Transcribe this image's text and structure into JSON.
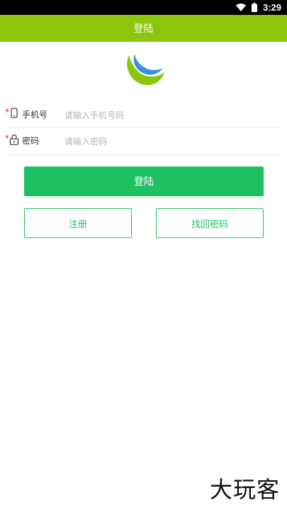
{
  "status_bar": {
    "time": "3:29",
    "wifi_icon": "wifi-icon",
    "battery_icon": "battery-icon"
  },
  "header": {
    "title": "登陆",
    "background": "#8bc50c"
  },
  "logo": {
    "icon": "crescent-logo-icon",
    "colors": [
      "#8bc50c",
      "#3f8fe0"
    ]
  },
  "form": {
    "phone": {
      "required_mark": "*",
      "icon": "phone-icon",
      "label": "手机号",
      "value": "",
      "placeholder": "请输入手机号码"
    },
    "password": {
      "required_mark": "*",
      "icon": "lock-icon",
      "label": "密码",
      "value": "",
      "placeholder": "请输入密码"
    }
  },
  "actions": {
    "login_label": "登陆",
    "register_label": "注册",
    "forgot_label": "找回密码",
    "accent": "#1ec162"
  },
  "watermark": {
    "text": "大玩客"
  }
}
